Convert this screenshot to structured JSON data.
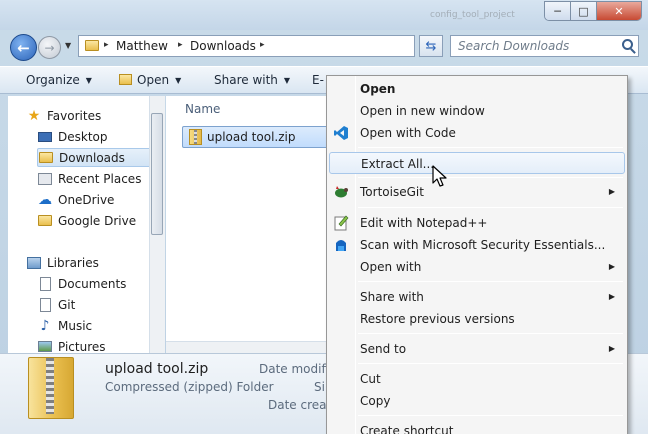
{
  "window": {
    "background_title_text": [
      "config_tool_project"
    ],
    "buttons": {
      "minimize": "─",
      "maximize": "□",
      "close": "✕"
    }
  },
  "address_bar": {
    "crumbs": [
      "Matthew",
      "Downloads"
    ],
    "separator": "▸",
    "search_placeholder": "Search Downloads"
  },
  "command_bar": {
    "organize": "Organize",
    "open": "Open",
    "share_with": "Share with",
    "truncated_next": "E-"
  },
  "nav": {
    "favorites_label": "Favorites",
    "favorites": [
      {
        "label": "Desktop",
        "icon": "desktop-icon"
      },
      {
        "label": "Downloads",
        "icon": "downloads-folder-icon",
        "selected": true
      },
      {
        "label": "Recent Places",
        "icon": "recent-places-icon"
      },
      {
        "label": "OneDrive",
        "icon": "onedrive-icon"
      },
      {
        "label": "Google Drive",
        "icon": "google-drive-icon"
      }
    ],
    "libraries_label": "Libraries",
    "libraries": [
      {
        "label": "Documents",
        "icon": "documents-icon"
      },
      {
        "label": "Git",
        "icon": "git-library-icon"
      },
      {
        "label": "Music",
        "icon": "music-icon"
      },
      {
        "label": "Pictures",
        "icon": "pictures-icon"
      }
    ]
  },
  "file_list": {
    "column_name": "Name",
    "files": [
      {
        "name": "upload tool.zip",
        "selected": true
      }
    ]
  },
  "details_pane": {
    "file_name": "upload tool.zip",
    "file_type": "Compressed (zipped) Folder",
    "labels": [
      "Date modifie",
      "Si",
      "Date create"
    ]
  },
  "context_menu": {
    "items": [
      {
        "label": "Open",
        "bold": true
      },
      {
        "label": "Open in new window"
      },
      {
        "label": "Open with Code",
        "icon": "vscode-icon"
      },
      {
        "label": "Extract All...",
        "hover": true
      },
      {
        "label": "TortoiseGit",
        "icon": "tortoisegit-icon",
        "submenu": true
      },
      {
        "label": "Edit with Notepad++",
        "icon": "notepadpp-icon"
      },
      {
        "label": "Scan with Microsoft Security Essentials...",
        "icon": "security-essentials-icon"
      },
      {
        "label": "Open with",
        "submenu": true
      },
      {
        "label": "Share with",
        "submenu": true
      },
      {
        "label": "Restore previous versions"
      },
      {
        "label": "Send to",
        "submenu": true
      },
      {
        "label": "Cut"
      },
      {
        "label": "Copy"
      },
      {
        "label": "Create shortcut"
      }
    ],
    "submenu_arrow": "▶"
  },
  "colors": {
    "accent": "#2c64b9",
    "selection_fill": "#c1dcfc",
    "menu_hover_border": "#a8c7ea"
  }
}
